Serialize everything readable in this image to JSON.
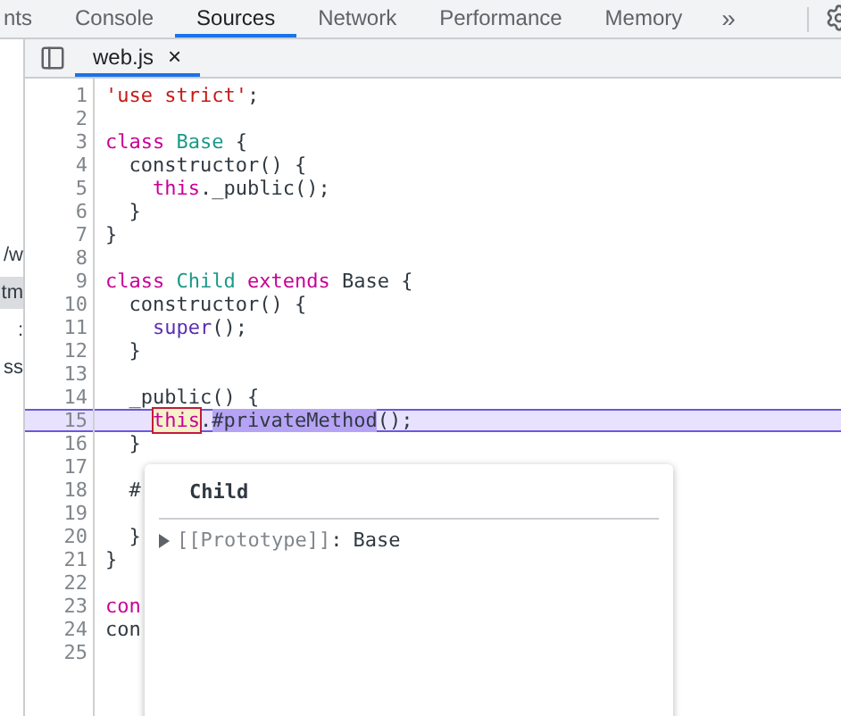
{
  "panel_tabs": [
    {
      "label": "nts",
      "selected": false
    },
    {
      "label": "Console",
      "selected": false
    },
    {
      "label": "Sources",
      "selected": true
    },
    {
      "label": "Network",
      "selected": false
    },
    {
      "label": "Performance",
      "selected": false
    },
    {
      "label": "Memory",
      "selected": false
    }
  ],
  "more_tabs": "»",
  "navigator": {
    "items": [
      {
        "label": "/w",
        "selected": false
      },
      {
        "label": "tm",
        "selected": true
      },
      {
        "label": ":",
        "selected": false
      },
      {
        "label": "ss",
        "selected": false
      }
    ]
  },
  "file_tab": {
    "label": "web.js",
    "close": "×",
    "selected": true
  },
  "lines": [
    {
      "number": "1",
      "current": false,
      "tokens": [
        {
          "text": "'use strict'",
          "kind": "string"
        },
        {
          "text": ";",
          "kind": "plain"
        }
      ]
    },
    {
      "number": "2",
      "current": false
    },
    {
      "number": "3",
      "current": false,
      "tokens": [
        {
          "text": "class",
          "kind": "keyword"
        },
        {
          "text": " Base",
          "kind": "def"
        },
        {
          "text": " {",
          "kind": "plain"
        }
      ]
    },
    {
      "number": "4",
      "current": false,
      "tokens": [
        {
          "text": "  constructor() {",
          "kind": "plain"
        }
      ]
    },
    {
      "number": "5",
      "current": false,
      "tokens": [
        {
          "text": "    this",
          "kind": "keyword"
        },
        {
          "text": "._public();",
          "kind": "plain"
        }
      ]
    },
    {
      "number": "6",
      "current": false,
      "tokens": [
        {
          "text": "  }",
          "kind": "plain"
        }
      ]
    },
    {
      "number": "7",
      "current": false,
      "tokens": [
        {
          "text": "}",
          "kind": "plain"
        }
      ]
    },
    {
      "number": "8",
      "current": false
    },
    {
      "number": "9",
      "current": false,
      "tokens": [
        {
          "text": "class",
          "kind": "keyword"
        },
        {
          "text": " Child",
          "kind": "def"
        },
        {
          "text": " extends",
          "kind": "keyword"
        },
        {
          "text": " Base {",
          "kind": "plain"
        }
      ]
    },
    {
      "number": "10",
      "current": false,
      "tokens": [
        {
          "text": "  constructor() {",
          "kind": "plain"
        }
      ]
    },
    {
      "number": "11",
      "current": false,
      "tokens": [
        {
          "text": "    super",
          "kind": "builtin"
        },
        {
          "text": "();",
          "kind": "plain"
        }
      ]
    },
    {
      "number": "12",
      "current": false,
      "tokens": [
        {
          "text": "  }",
          "kind": "plain"
        }
      ]
    },
    {
      "number": "13",
      "current": false
    },
    {
      "number": "14",
      "current": false,
      "tokens": [
        {
          "text": "  _public() {",
          "kind": "plain"
        }
      ]
    },
    {
      "number": "15",
      "current": true,
      "tokens": [
        {
          "text": "    this",
          "kind": "hovered"
        },
        {
          "text": ".",
          "kind": "plain"
        },
        {
          "text": "#privateMethod",
          "kind": "selection"
        },
        {
          "text": "();",
          "kind": "plain"
        }
      ]
    },
    {
      "number": "16",
      "current": false,
      "tokens": [
        {
          "text": "  }",
          "kind": "plain"
        }
      ]
    },
    {
      "number": "17",
      "current": false
    },
    {
      "number": "18",
      "current": false,
      "tokens": [
        {
          "text": "  #",
          "kind": "plain"
        }
      ]
    },
    {
      "number": "19",
      "current": false
    },
    {
      "number": "20",
      "current": false,
      "tokens": [
        {
          "text": "  }",
          "kind": "plain"
        }
      ]
    },
    {
      "number": "21",
      "current": false,
      "tokens": [
        {
          "text": "}",
          "kind": "plain"
        }
      ]
    },
    {
      "number": "22",
      "current": false
    },
    {
      "number": "23",
      "current": false,
      "tokens": [
        {
          "text": "con",
          "kind": "keyword"
        }
      ]
    },
    {
      "number": "24",
      "current": false,
      "tokens": [
        {
          "text": "con",
          "kind": "plain"
        }
      ]
    },
    {
      "number": "25",
      "current": false
    }
  ],
  "popover": {
    "title": "Child",
    "rows": [
      {
        "key": "[[Prototype]]",
        "separator": ":",
        "value": "Base",
        "expanded": false
      }
    ]
  }
}
